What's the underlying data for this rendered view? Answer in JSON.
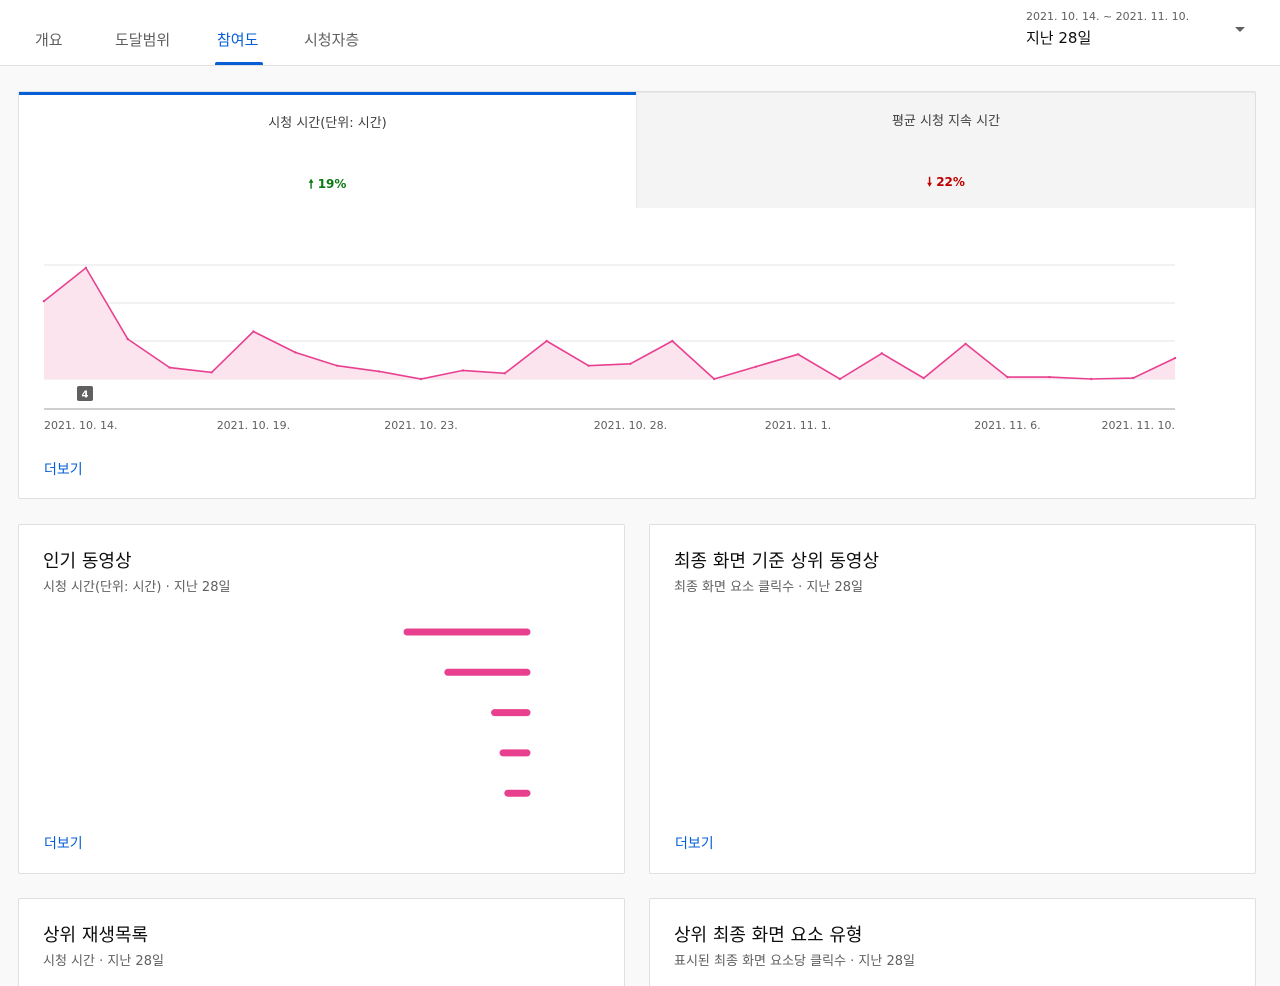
{
  "tabs": [
    "개요",
    "도달범위",
    "참여도",
    "시청자층"
  ],
  "date": {
    "range": "2021. 10. 14. ~ 2021. 11. 10.",
    "label": "지난 28일"
  },
  "metrics": [
    {
      "label": "시청 시간(단위: 시간)",
      "change": "19%",
      "direction": "up"
    },
    {
      "label": "평균 시청 지속 시간",
      "change": "22%",
      "direction": "down"
    }
  ],
  "chart_data": {
    "type": "area",
    "x": [
      "2021. 10. 14.",
      "2021. 10. 15.",
      "2021. 10. 16.",
      "2021. 10. 17.",
      "2021. 10. 18.",
      "2021. 10. 19.",
      "2021. 10. 20.",
      "2021. 10. 21.",
      "2021. 10. 22.",
      "2021. 10. 23.",
      "2021. 10. 24.",
      "2021. 10. 25.",
      "2021. 10. 26.",
      "2021. 10. 27.",
      "2021. 10. 28.",
      "2021. 10. 29.",
      "2021. 10. 30.",
      "2021. 10. 31.",
      "2021. 11. 1.",
      "2021. 11. 2.",
      "2021. 11. 3.",
      "2021. 11. 4.",
      "2021. 11. 5.",
      "2021. 11. 6.",
      "2021. 11. 7.",
      "2021. 11. 8.",
      "2021. 11. 9.",
      "2021. 11. 10."
    ],
    "y": [
      8.2,
      11.7,
      4.2,
      1.2,
      0.7,
      5.0,
      2.8,
      1.4,
      0.8,
      0.0,
      0.9,
      0.6,
      4.0,
      1.4,
      1.6,
      4.0,
      0.0,
      1.3,
      2.6,
      0.0,
      2.7,
      0.1,
      3.7,
      0.2,
      0.2,
      0.0,
      0.1,
      2.2
    ],
    "y_gridlines": [
      0,
      4,
      8,
      12
    ],
    "ylim": [
      0,
      12
    ],
    "xticks": [
      "2021. 10. 14.",
      "2021. 10. 19.",
      "2021. 10. 23.",
      "2021. 10. 28.",
      "2021. 11. 1.",
      "2021. 11. 6.",
      "2021. 11. 10."
    ],
    "marker": "4",
    "color": "#e8408f"
  },
  "more_label": "더보기",
  "popular_videos": {
    "title": "인기 동영상",
    "subtitle": "시청 시간(단위: 시간) · 지난 28일",
    "chart_data": {
      "type": "bar",
      "values": [
        1.0,
        0.66,
        0.27,
        0.2,
        0.16
      ],
      "color": "#e8408f"
    }
  },
  "end_screen_videos": {
    "title": "최종 화면 기준 상위 동영상",
    "subtitle": "최종 화면 요소 클릭수 · 지난 28일"
  },
  "top_playlists": {
    "title": "상위 재생목록",
    "subtitle": "시청 시간 · 지난 28일"
  },
  "end_screen_types": {
    "title": "상위 최종 화면 요소 유형",
    "subtitle": "표시된 최종 화면 요소당 클릭수 · 지난 28일"
  }
}
